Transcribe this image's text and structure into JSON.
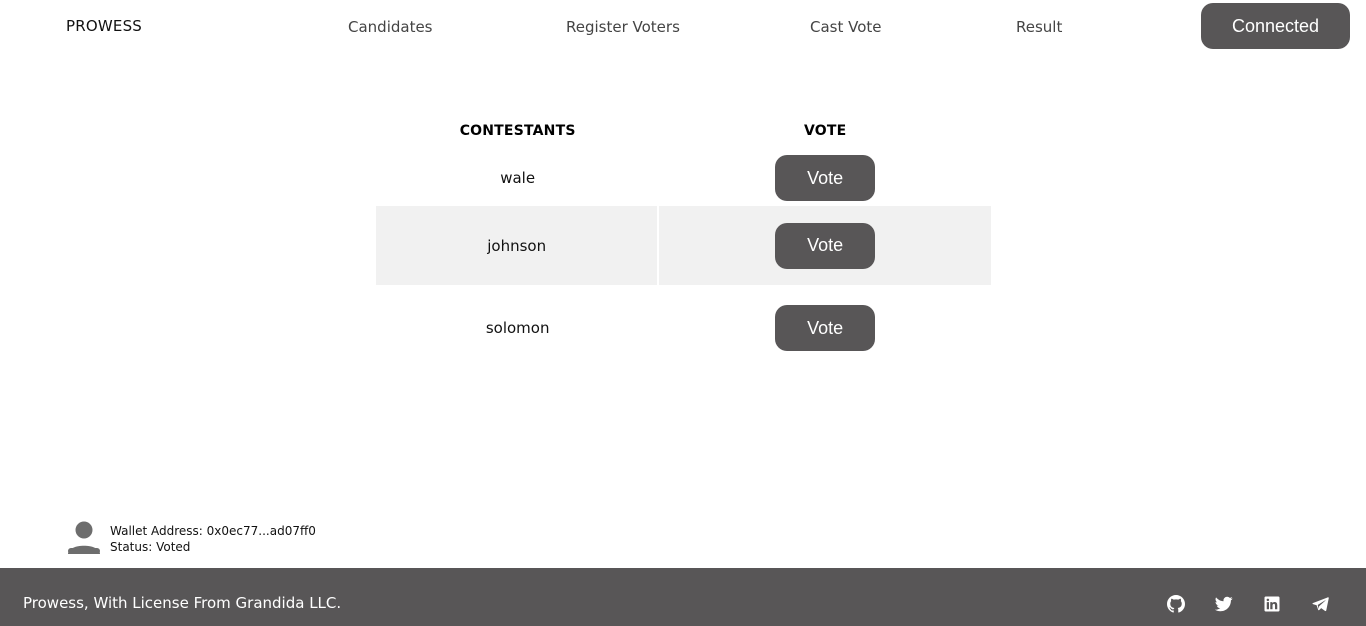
{
  "nav": {
    "brand": "PROWESS",
    "links": [
      "Candidates",
      "Register Voters",
      "Cast Vote",
      "Result"
    ],
    "connect_label": "Connected"
  },
  "table": {
    "headers": [
      "CONTESTANTS",
      "VOTE"
    ],
    "rows": [
      {
        "name": "wale",
        "button": "Vote"
      },
      {
        "name": "johnson",
        "button": "Vote"
      },
      {
        "name": "solomon",
        "button": "Vote"
      }
    ]
  },
  "wallet": {
    "address_line": "Wallet Address: 0x0ec77...ad07ff0",
    "status_line": "Status: Voted",
    "icon": "user-icon"
  },
  "footer": {
    "text": "Prowess, With License From Grandida LLC.",
    "socials": [
      "github-icon",
      "twitter-icon",
      "linkedin-icon",
      "telegram-icon"
    ]
  },
  "colors": {
    "button_bg": "#585657",
    "footer_bg": "#585657",
    "stripe": "#f1f1f1"
  }
}
